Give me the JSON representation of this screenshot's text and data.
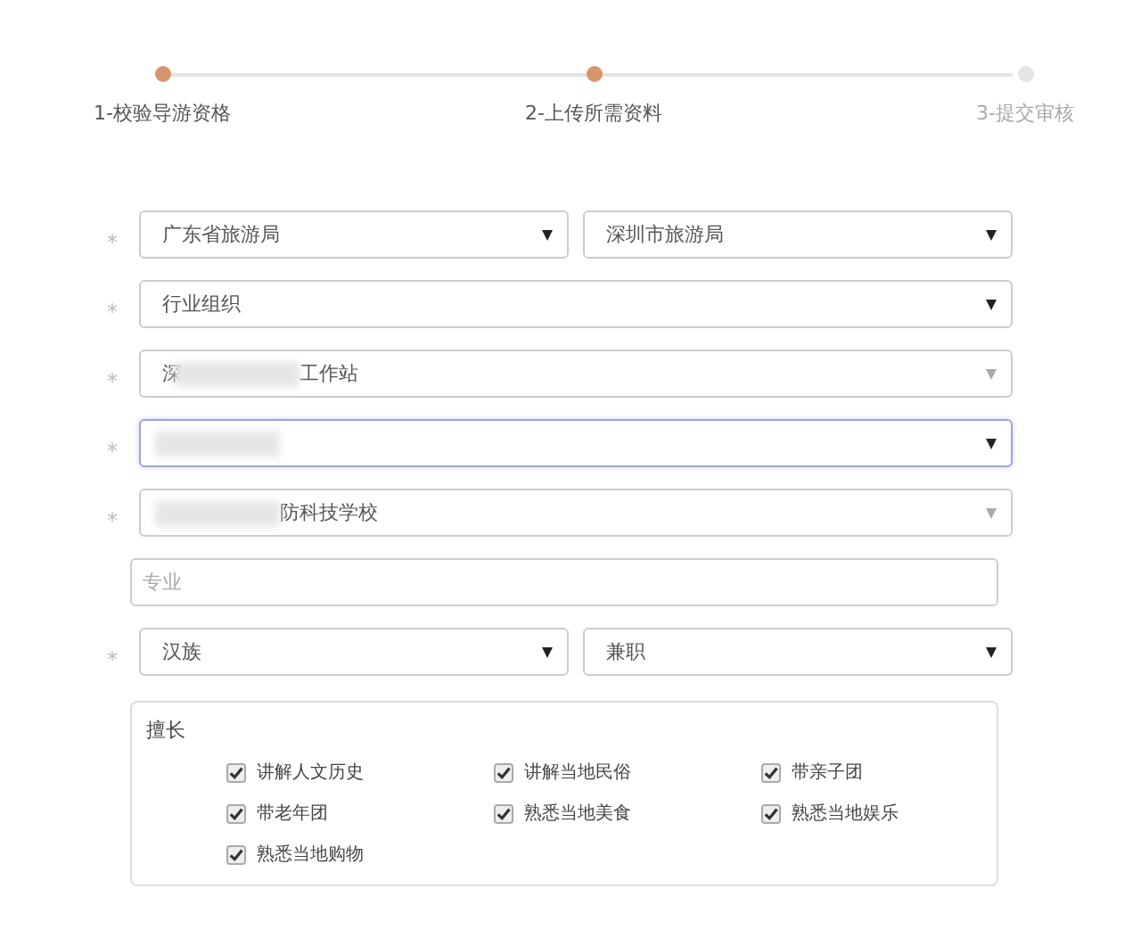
{
  "steps": [
    {
      "label": "1-校验导游资格",
      "done": true
    },
    {
      "label": "2-上传所需资料",
      "done": true
    },
    {
      "label": "3-提交审核",
      "done": false
    }
  ],
  "form": [
    {
      "kind": "select-pair",
      "mark": "*",
      "fields": [
        {
          "value": "广东省旅游局",
          "redacted": false,
          "disabled": false,
          "focused": false
        },
        {
          "value": "深圳市旅游局",
          "redacted": false,
          "disabled": false,
          "focused": false
        }
      ]
    },
    {
      "kind": "select",
      "mark": "*",
      "fields": [
        {
          "value": "行业组织",
          "redacted": false,
          "disabled": false,
          "focused": false
        }
      ]
    },
    {
      "kind": "select",
      "mark": "*",
      "fields": [
        {
          "value": "深",
          "value_after": "工作站",
          "redacted": true,
          "disabled": true,
          "focused": false
        }
      ]
    },
    {
      "kind": "select",
      "mark": "*",
      "fields": [
        {
          "redacted": true,
          "disabled": false,
          "focused": true
        }
      ]
    },
    {
      "kind": "select",
      "mark": "*",
      "fields": [
        {
          "value_after": "防科技学校",
          "redacted": true,
          "disabled": true,
          "focused": false
        }
      ]
    },
    {
      "kind": "input",
      "placeholder": "专业"
    },
    {
      "kind": "select-pair",
      "mark": "*",
      "fields": [
        {
          "value": "汉族",
          "redacted": false,
          "disabled": false,
          "focused": false
        },
        {
          "value": "兼职",
          "redacted": false,
          "disabled": false,
          "focused": false
        }
      ]
    },
    {
      "kind": "skills",
      "title": "擅长",
      "options": [
        {
          "label": "讲解人文历史",
          "checked": true
        },
        {
          "label": "讲解当地民俗",
          "checked": true
        },
        {
          "label": "带亲子团",
          "checked": true
        },
        {
          "label": "带老年团",
          "checked": true
        },
        {
          "label": "熟悉当地美食",
          "checked": true
        },
        {
          "label": "熟悉当地娱乐",
          "checked": true
        },
        {
          "label": "熟悉当地购物",
          "checked": true
        }
      ]
    }
  ]
}
